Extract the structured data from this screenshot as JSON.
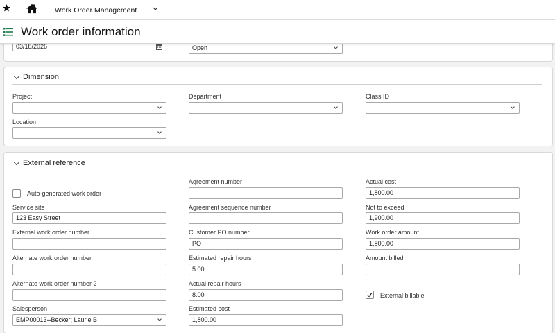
{
  "nav": {
    "app_name": "Work Order Management"
  },
  "page": {
    "title": "Work order information"
  },
  "top_fields": {
    "date_value": "03/18/2026",
    "status_value": "Open"
  },
  "dimension": {
    "title": "Dimension",
    "project_label": "Project",
    "project_value": "",
    "department_label": "Department",
    "department_value": "",
    "class_label": "Class ID",
    "class_value": "",
    "location_label": "Location",
    "location_value": ""
  },
  "external": {
    "title": "External reference",
    "auto_generated_label": "Auto-generated work order",
    "service_site_label": "Service site",
    "service_site_value": "123 Easy Street",
    "ext_wo_number_label": "External work order number",
    "ext_wo_number_value": "",
    "alt_wo_number_label": "Alternate work order number",
    "alt_wo_number_value": "",
    "alt_wo_number2_label": "Alternate work order number 2",
    "alt_wo_number2_value": "",
    "salesperson_label": "Salesperson",
    "salesperson_value": "EMP00013--Becker; Laurie B",
    "agreement_number_label": "Agreement number",
    "agreement_number_value": "",
    "agreement_seq_label": "Agreement sequence number",
    "agreement_seq_value": "",
    "customer_po_label": "Customer PO number",
    "customer_po_value": "PO",
    "est_repair_hours_label": "Estimated repair hours",
    "est_repair_hours_value": "5.00",
    "actual_repair_hours_label": "Actual repair hours",
    "actual_repair_hours_value": "8.00",
    "estimated_cost_label": "Estimated cost",
    "estimated_cost_value": "1,800.00",
    "actual_cost_label": "Actual cost",
    "actual_cost_value": "1,800.00",
    "not_to_exceed_label": "Not to exceed",
    "not_to_exceed_value": "1,900.00",
    "wo_amount_label": "Work order amount",
    "wo_amount_value": "1,800.00",
    "amount_billed_label": "Amount billed",
    "amount_billed_value": "",
    "external_billable_label": "External billable",
    "auto_generated_checked": false,
    "external_billable_checked": true
  },
  "icons": {
    "star": "star-icon",
    "home": "home-icon",
    "menu": "list-menu-icon",
    "calendar": "calendar-icon"
  },
  "colors": {
    "accent": "#1f7a4d"
  }
}
